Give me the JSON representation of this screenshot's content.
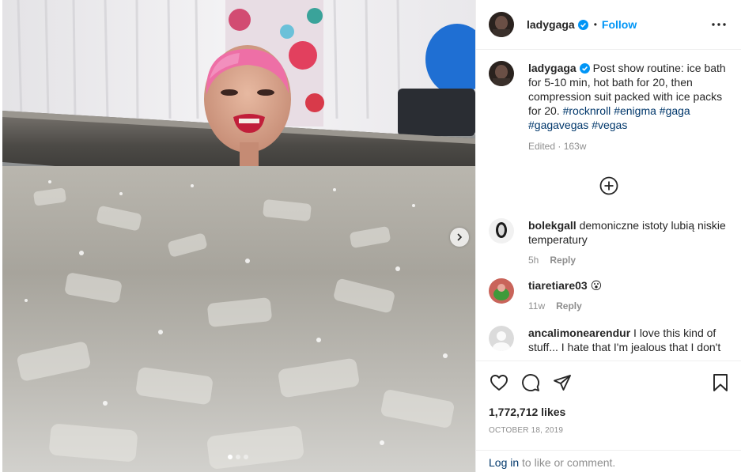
{
  "photo": {
    "description_icon": "ice-bath-photo",
    "carousel_total": 3,
    "carousel_active_index": 0
  },
  "header": {
    "username": "ladygaga",
    "separator": "•",
    "follow_label": "Follow"
  },
  "caption": {
    "username": "ladygaga",
    "text": "Post show routine: ice bath for 5-10 min, hot bath for 20, then compression suit packed with ice packs for 20.",
    "hashtags": [
      "#rocknroll",
      "#enigma",
      "#gaga",
      "#gagavegas",
      "#vegas"
    ],
    "meta": "Edited · 163w"
  },
  "comments": [
    {
      "username": "bolekgall",
      "text": "demoniczne istoty lubią niskie temperatury",
      "age": "5h",
      "reply_label": "Reply"
    },
    {
      "username": "tiaretiare03",
      "text": "😮",
      "age": "11w",
      "reply_label": "Reply"
    },
    {
      "username": "ancalimonearendur",
      "text": "I love this kind of stuff... I hate that I'm jealous that I don't",
      "age": "",
      "reply_label": ""
    }
  ],
  "actions": {
    "likes": "1,772,712 likes",
    "date": "OCTOBER 18, 2019",
    "login_link": "Log in",
    "login_rest": " to like or comment."
  },
  "colors": {
    "accent": "#0095f6",
    "hashtag": "#00376b",
    "muted": "#8e8e8e",
    "text": "#262626"
  }
}
